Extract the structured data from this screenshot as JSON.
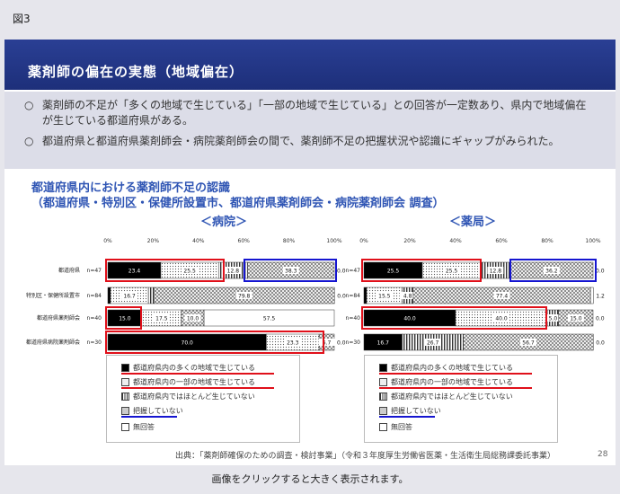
{
  "figure_label": "図3",
  "slide_title": "薬剤師の偏在の実態（地域偏在）",
  "bullets": [
    {
      "mark": "○",
      "text": "薬剤師の不足が「多くの地域で生じている」「一部の地域で生じている」との回答が一定数あり、県内で地域偏在が生じている都道府県がある。"
    },
    {
      "mark": "○",
      "text": "都道府県と都道府県薬剤師会・病院薬剤師会の間で、薬剤師不足の把握状況や認識にギャップがみられた。"
    }
  ],
  "chart_title_line1": "都道府県内における薬剤師不足の認識",
  "chart_title_line2": "（都道府県・特別区・保健所設置市、都道府県薬剤師会・病院薬剤師会 調査）",
  "source": "出典：「薬剤師確保のための調査・検討事業」（令和３年度厚生労働省医薬・生活衛生局総務課委託事業）",
  "page_number": "28",
  "caption": "画像をクリックすると大きく表示されます。",
  "colors": {
    "title_bar": "#1d2f7a",
    "highlight_red": "#e0101a",
    "highlight_blue": "#1515d0",
    "chart_title": "#2f55b4"
  },
  "chart_data": [
    {
      "type": "bar",
      "stacked": "horizontal-100%",
      "title": "＜病院＞",
      "axis_ticks": [
        "0%",
        "20%",
        "40%",
        "60%",
        "80%",
        "100%"
      ],
      "xlim": [
        0,
        100
      ],
      "categories": [
        {
          "label": "都道府県",
          "n": "n=47"
        },
        {
          "label": "特別区・保健所設置市",
          "n": "n=84"
        },
        {
          "label": "都道府県薬剤師会",
          "n": "n=40"
        },
        {
          "label": "都道府県病院薬剤師会",
          "n": "n=30"
        }
      ],
      "series": [
        {
          "name": "都道府県内の多くの地域で生じている",
          "pattern": "solid-black",
          "values": [
            23.4,
            1.2,
            15.0,
            70.0
          ],
          "labels": [
            "23.4",
            "1.2",
            "15.0",
            "70.0"
          ]
        },
        {
          "name": "都道府県内の一部の地域で生じている",
          "pattern": "dots",
          "values": [
            25.5,
            16.7,
            17.5,
            23.3
          ],
          "labels": [
            "25.5",
            "16.7",
            "17.5",
            "23.3"
          ]
        },
        {
          "name": "都道府県内ではほとんど生じていない",
          "pattern": "vertical-lines",
          "values": [
            12.8,
            2.4,
            0.0,
            0.0
          ],
          "labels": [
            "12.8",
            "2.4",
            "0.0",
            "0.0"
          ]
        },
        {
          "name": "把握していない",
          "pattern": "crosshatch",
          "values": [
            38.3,
            79.8,
            10.0,
            6.7
          ],
          "labels": [
            "38.3",
            "79.8",
            "10.0",
            "6.7"
          ]
        },
        {
          "name": "無回答",
          "pattern": "white",
          "values": [
            0.0,
            0.0,
            57.5,
            0.0
          ],
          "labels": [
            "0.0",
            "0.0",
            "57.5",
            "0.0"
          ]
        }
      ]
    },
    {
      "type": "bar",
      "stacked": "horizontal-100%",
      "title": "＜薬局＞",
      "axis_ticks": [
        "0%",
        "20%",
        "40%",
        "60%",
        "80%",
        "100%"
      ],
      "xlim": [
        0,
        100
      ],
      "categories": [
        {
          "label": "",
          "n": "n=47"
        },
        {
          "label": "",
          "n": "n=84"
        },
        {
          "label": "",
          "n": "n=40"
        },
        {
          "label": "",
          "n": "n=30"
        }
      ],
      "series": [
        {
          "name": "都道府県内の多くの地域で生じている",
          "pattern": "solid-black",
          "values": [
            25.5,
            1.2,
            40.0,
            16.7
          ],
          "labels": [
            "25.5",
            "1.2",
            "40.0",
            "16.7"
          ]
        },
        {
          "name": "都道府県内の一部の地域で生じている",
          "pattern": "dots",
          "values": [
            25.5,
            15.5,
            40.0,
            0.0
          ],
          "labels": [
            "25.5",
            "15.5",
            "40.0",
            "0.0"
          ]
        },
        {
          "name": "都道府県内ではほとんど生じていない",
          "pattern": "vertical-lines",
          "values": [
            12.8,
            4.8,
            5.0,
            26.7
          ],
          "labels": [
            "12.8",
            "4.8",
            "5.0",
            "26.7"
          ]
        },
        {
          "name": "把握していない",
          "pattern": "crosshatch",
          "values": [
            36.2,
            77.4,
            15.0,
            56.7
          ],
          "labels": [
            "36.2",
            "77.4",
            "15.0",
            "56.7"
          ]
        },
        {
          "name": "無回答",
          "pattern": "white",
          "values": [
            0.0,
            1.2,
            0.0,
            0.0
          ],
          "labels": [
            "0.0",
            "1.2",
            "0.0",
            "0.0"
          ]
        }
      ]
    }
  ],
  "legend": [
    {
      "label": "都道府県内の多くの地域で生じている",
      "pattern": "solid-black",
      "underline": "red"
    },
    {
      "label": "都道府県内の一部の地域で生じている",
      "pattern": "dots",
      "underline": "red"
    },
    {
      "label": "都道府県内ではほとんど生じていない",
      "pattern": "vertical-lines",
      "underline": ""
    },
    {
      "label": "把握していない",
      "pattern": "crosshatch",
      "underline": "blue"
    },
    {
      "label": "無回答",
      "pattern": "white",
      "underline": ""
    }
  ]
}
